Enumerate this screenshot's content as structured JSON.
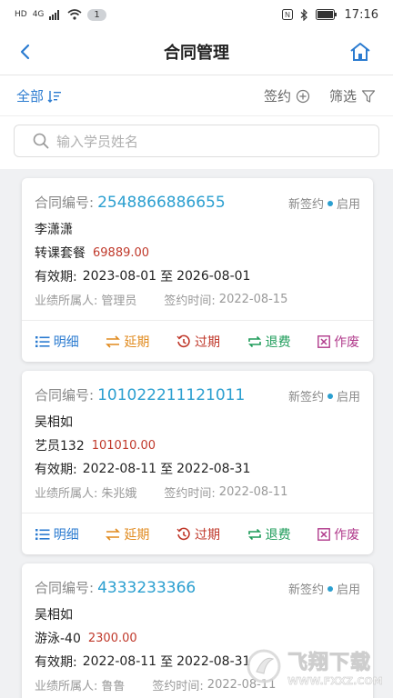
{
  "status_bar": {
    "sim": "HD",
    "network": "4G",
    "notifications": "1",
    "time": "17:16"
  },
  "header": {
    "title": "合同管理"
  },
  "toolbar": {
    "all_label": "全部",
    "sign_label": "签约",
    "filter_label": "筛选"
  },
  "search": {
    "placeholder": "输入学员姓名"
  },
  "labels": {
    "contract_no": "合同编号:",
    "validity": "有效期:",
    "to": "至",
    "owner": "业绩所属人:",
    "sign_time": "签约时间:"
  },
  "actions": {
    "detail": "明细",
    "extend": "延期",
    "expire": "过期",
    "refund": "退费",
    "void": "作废"
  },
  "contracts": [
    {
      "number": "2548866886655",
      "type": "新签约",
      "state": "启用",
      "student": "李潇潇",
      "course": "转课套餐",
      "price": "69889.00",
      "start": "2023-08-01",
      "end": "2026-08-01",
      "owner": "管理员",
      "sign_date": "2022-08-15"
    },
    {
      "number": "101022211121011",
      "type": "新签约",
      "state": "启用",
      "student": "吴相如",
      "course": "艺员132",
      "price": "101010.00",
      "start": "2022-08-11",
      "end": "2022-08-31",
      "owner": "朱兆娥",
      "sign_date": "2022-08-11"
    },
    {
      "number": "4333233366",
      "type": "新签约",
      "state": "启用",
      "student": "吴相如",
      "course": "游泳-40",
      "price": "2300.00",
      "start": "2022-08-11",
      "end": "2022-08-31",
      "owner": "鲁鲁",
      "sign_date": "2022-08-11"
    }
  ],
  "watermark": {
    "text": "飞翔下载",
    "url": "WWW.FXXZ.COM"
  },
  "colors": {
    "accent": "#2b7bd0",
    "link": "#2b9fd0",
    "price": "#c0392b",
    "extend": "#e08a1e",
    "refund": "#1e9c5a",
    "void": "#b03a8b"
  }
}
